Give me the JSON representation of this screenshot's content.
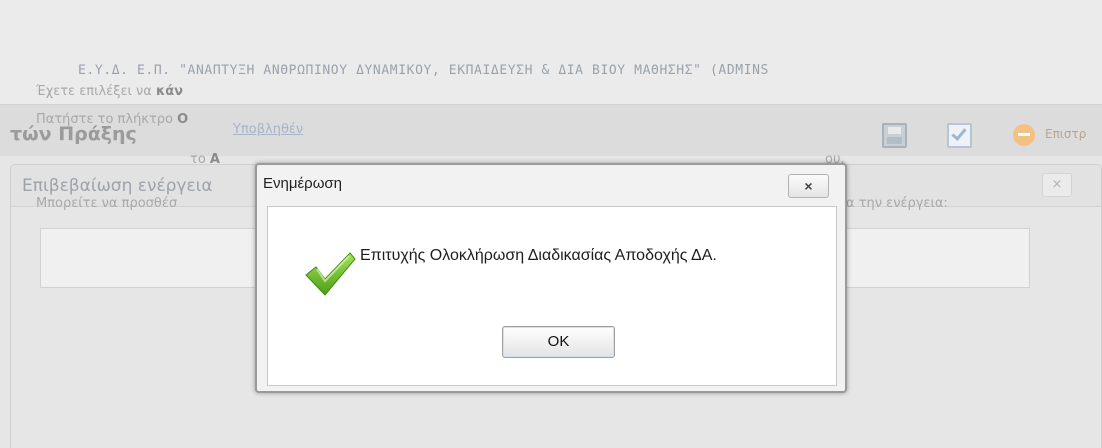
{
  "background": {
    "organization_title": "Ε.Υ.Δ. Ε.Π. \"ΑΝΑΠΤΥΞΗ ΑΝΘΡΩΠΙΝΟΥ ΔΥΝΑΜΙΚΟΥ, ΕΚΠΑΙΔΕΥΣΗ & ΔΙΑ ΒΙΟΥ ΜΑΘΗΣΗΣ\" (ADMINS",
    "page_title": "τών Πράξης",
    "status_link": "Υποβληθέν",
    "back_label": "Επιστρ",
    "icons": [
      "save-icon",
      "check-icon",
      "back-icon"
    ]
  },
  "confirm_dialog": {
    "title": "Επιβεβαίωση ενέργεια",
    "close_label": "×",
    "line1_prefix": "Έχετε επιλέξει να ",
    "line1_bold": "κάν",
    "line2_prefix": "Πατήστε το πλήκτρο ",
    "line2_bold": "Ο",
    "line3_prefix": "το ",
    "line3_bold": "Α",
    "line3_suffix": "ου.",
    "line4_prefix": "Μπορείτε να προσθέσ",
    "line4_suffix": "α την ενέργεια:"
  },
  "alert": {
    "title": "Ενημέρωση",
    "close_label": "×",
    "message": "Επιτυχής Ολοκλήρωση Διαδικασίας Αποδοχής ΔΑ.",
    "ok_label": "OK",
    "icon": "success-check-icon"
  },
  "colors": {
    "success_green": "#6fbf2a",
    "overlay_text": "#9aa2ad"
  }
}
